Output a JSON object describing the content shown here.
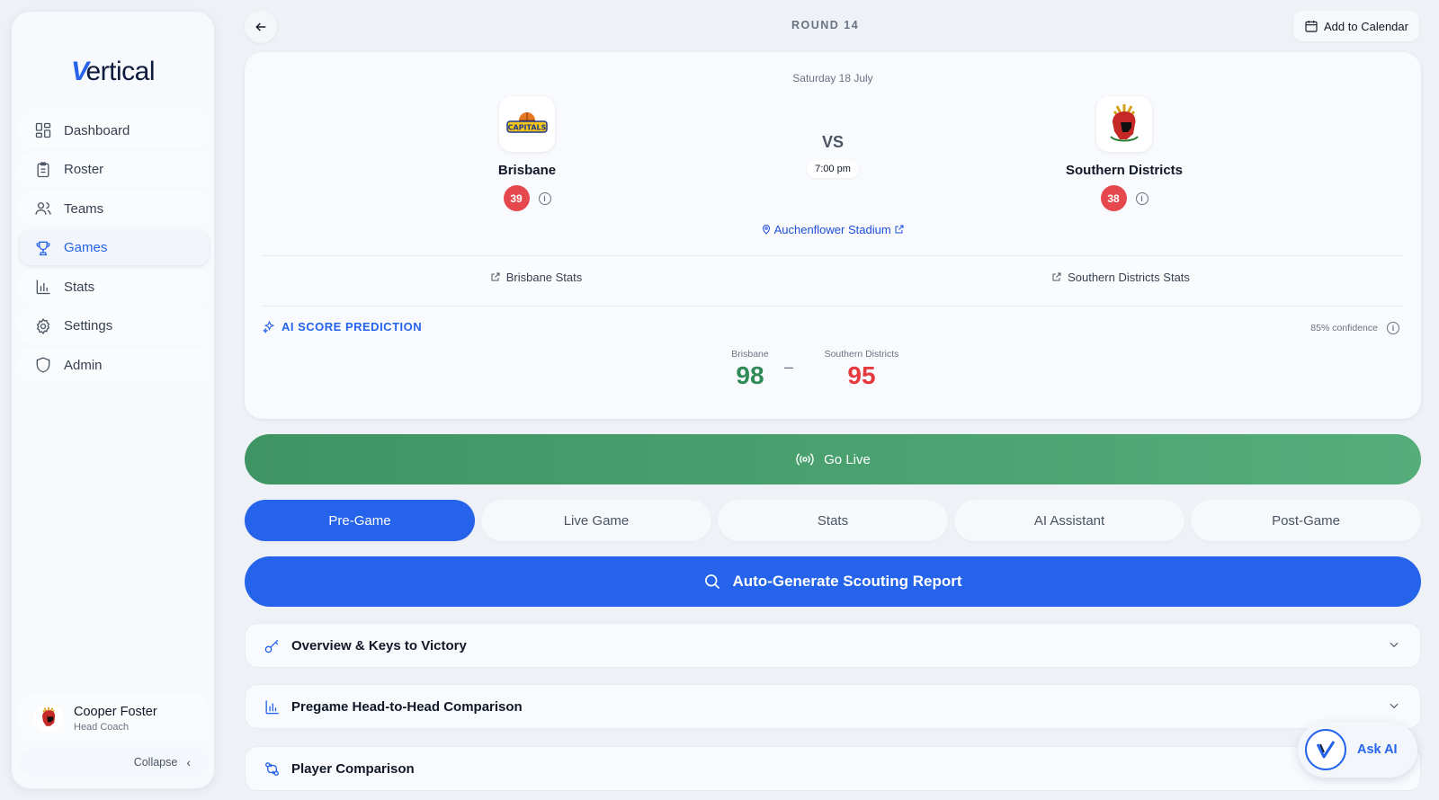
{
  "brand": {
    "logo_v": "V",
    "logo_rest": "ertical"
  },
  "sidebar": {
    "items": [
      {
        "label": "Dashboard",
        "icon": "dashboard-icon"
      },
      {
        "label": "Roster",
        "icon": "clipboard-icon"
      },
      {
        "label": "Teams",
        "icon": "users-icon"
      },
      {
        "label": "Games",
        "icon": "trophy-icon",
        "active": true
      },
      {
        "label": "Stats",
        "icon": "bar-chart-icon"
      },
      {
        "label": "Settings",
        "icon": "gear-icon"
      },
      {
        "label": "Admin",
        "icon": "shield-icon"
      }
    ],
    "user": {
      "name": "Cooper Foster",
      "role": "Head Coach"
    },
    "collapse_label": "Collapse"
  },
  "header": {
    "round": "ROUND 14",
    "calendar_label": "Add to Calendar"
  },
  "match": {
    "date": "Saturday 18 July",
    "vs": "VS",
    "time": "7:00 pm",
    "venue": "Auchenflower Stadium",
    "home": {
      "name": "Brisbane",
      "rating": "39",
      "logo_text": "CAPITALS",
      "stats_label": "Brisbane Stats"
    },
    "away": {
      "name": "Southern Districts",
      "rating": "38",
      "stats_label": "Southern Districts Stats"
    }
  },
  "prediction": {
    "title": "AI SCORE PREDICTION",
    "confidence": "85% confidence",
    "home_label": "Brisbane",
    "home_score": "98",
    "away_label": "Southern Districts",
    "away_score": "95",
    "dash": "–",
    "home_color": "#2f8a55",
    "away_color": "#e5393e"
  },
  "go_live_label": "Go Live",
  "tabs": [
    "Pre-Game",
    "Live Game",
    "Stats",
    "AI Assistant",
    "Post-Game"
  ],
  "scouting_label": "Auto-Generate Scouting Report",
  "sections": [
    {
      "label": "Overview & Keys to Victory",
      "icon": "key-icon"
    },
    {
      "label": "Pregame Head-to-Head Comparison",
      "icon": "bar-chart-icon"
    },
    {
      "label": "Player Comparison",
      "icon": "swap-icon"
    }
  ],
  "ask_ai_label": "Ask AI",
  "colors": {
    "accent": "#2563eb",
    "live": "#4a9f6d",
    "badge": "#e5494d"
  }
}
